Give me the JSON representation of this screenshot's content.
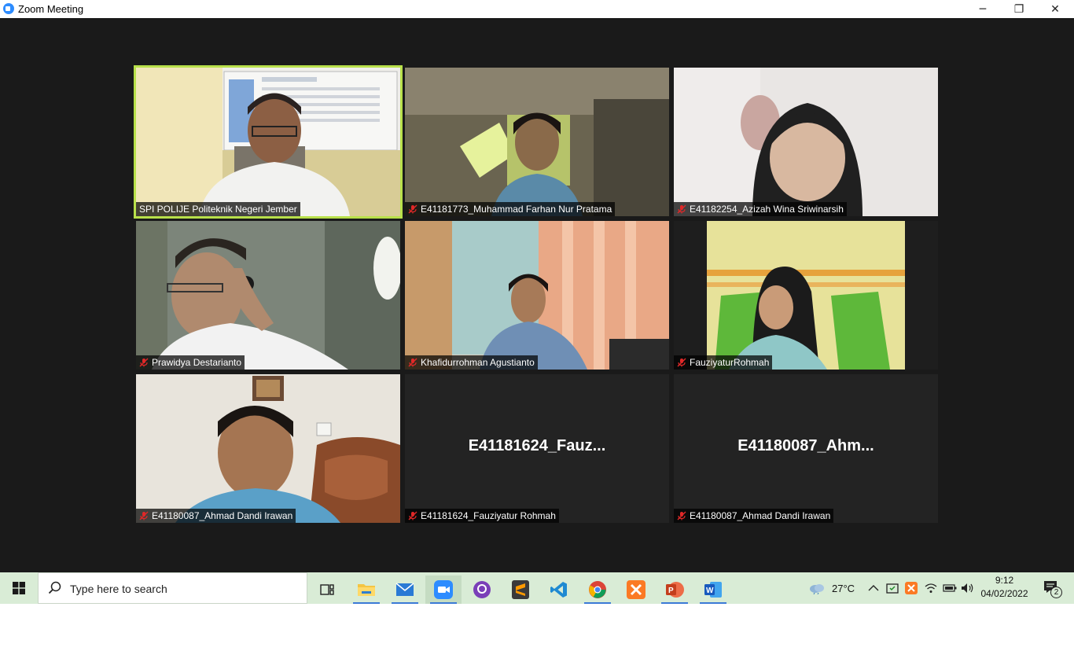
{
  "window": {
    "title": "Zoom Meeting",
    "minimize": "─",
    "restore": "❐",
    "close": "✕"
  },
  "participants": [
    {
      "name": "SPI POLIJE Politeknik Negeri Jember",
      "muted": false,
      "active": true,
      "video": "man-office"
    },
    {
      "name": "E41181773_Muhammad Farhan Nur Pratama",
      "muted": true,
      "active": false,
      "video": "man-dim-room"
    },
    {
      "name": "E41182254_Azizah Wina Sriwinarsih",
      "muted": true,
      "active": false,
      "video": "woman-hijab-bright"
    },
    {
      "name": "Prawidya Destarianto",
      "muted": true,
      "active": false,
      "video": "man-headset"
    },
    {
      "name": "Khafidurrohman Agustianto",
      "muted": true,
      "active": false,
      "video": "man-batik-curtain"
    },
    {
      "name": "FauziyaturRohmah",
      "muted": true,
      "active": false,
      "video": "woman-hijab-green"
    },
    {
      "name": "E41180087_Ahmad Dandi Irawan",
      "muted": true,
      "active": false,
      "video": "man-sofa"
    },
    {
      "name": "E41181624_Fauziyatur Rohmah",
      "muted": true,
      "active": false,
      "video": "none",
      "display_name": "E41181624_Fauz..."
    },
    {
      "name": "E41180087_Ahmad Dandi Irawan",
      "muted": true,
      "active": false,
      "video": "none",
      "display_name": "E41180087_Ahm..."
    }
  ],
  "taskbar": {
    "search_placeholder": "Type here to search",
    "apps": [
      "task-view",
      "file-explorer",
      "mail",
      "zoom",
      "github-desktop",
      "sublime-text",
      "vscode",
      "chrome",
      "xampp",
      "powerpoint",
      "word"
    ],
    "weather": "27°C",
    "time": "9:12",
    "date": "04/02/2022",
    "notification_count": "2"
  },
  "colors": {
    "accent": "#b8e04a",
    "zoom_blue": "#2D8CFF",
    "taskbar_bg": "#d9ecd6",
    "mute_red": "#e02828"
  }
}
